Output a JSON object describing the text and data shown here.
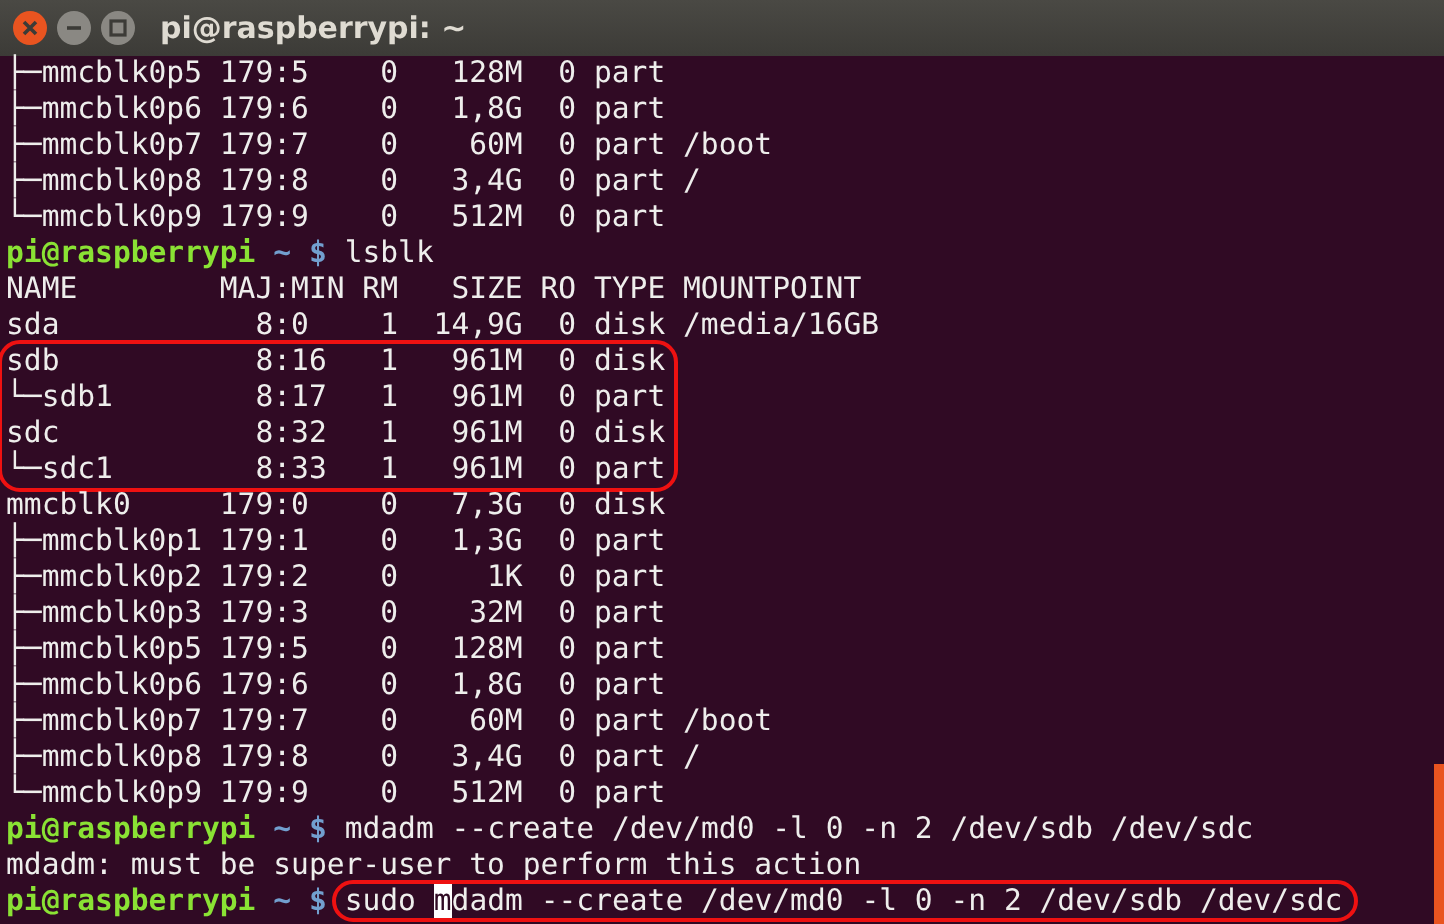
{
  "window": {
    "title": "pi@raspberrypi: ~"
  },
  "terminal": {
    "lines": [
      {
        "kind": "output",
        "text": "├─mmcblk0p5 179:5    0   128M  0 part",
        "highlighted": false
      },
      {
        "kind": "output",
        "text": "├─mmcblk0p6 179:6    0   1,8G  0 part",
        "highlighted": false
      },
      {
        "kind": "output",
        "text": "├─mmcblk0p7 179:7    0    60M  0 part /boot",
        "highlighted": false
      },
      {
        "kind": "output",
        "text": "├─mmcblk0p8 179:8    0   3,4G  0 part /",
        "highlighted": false
      },
      {
        "kind": "output",
        "text": "└─mmcblk0p9 179:9    0   512M  0 part",
        "highlighted": false
      },
      {
        "kind": "prompt",
        "user_host": "pi@raspberrypi",
        "path": "~",
        "symbol": "$",
        "command": "lsblk",
        "highlighted": false
      },
      {
        "kind": "output",
        "text": "NAME        MAJ:MIN RM   SIZE RO TYPE MOUNTPOINT",
        "highlighted": false
      },
      {
        "kind": "output",
        "text": "sda           8:0    1  14,9G  0 disk /media/16GB",
        "highlighted": false
      },
      {
        "kind": "output",
        "text": "sdb           8:16   1   961M  0 disk",
        "highlighted": true
      },
      {
        "kind": "output",
        "text": "└─sdb1        8:17   1   961M  0 part",
        "highlighted": true
      },
      {
        "kind": "output",
        "text": "sdc           8:32   1   961M  0 disk",
        "highlighted": true
      },
      {
        "kind": "output",
        "text": "└─sdc1        8:33   1   961M  0 part",
        "highlighted": true
      },
      {
        "kind": "output",
        "text": "mmcblk0     179:0    0   7,3G  0 disk",
        "highlighted": false
      },
      {
        "kind": "output",
        "text": "├─mmcblk0p1 179:1    0   1,3G  0 part",
        "highlighted": false
      },
      {
        "kind": "output",
        "text": "├─mmcblk0p2 179:2    0     1K  0 part",
        "highlighted": false
      },
      {
        "kind": "output",
        "text": "├─mmcblk0p3 179:3    0    32M  0 part",
        "highlighted": false
      },
      {
        "kind": "output",
        "text": "├─mmcblk0p5 179:5    0   128M  0 part",
        "highlighted": false
      },
      {
        "kind": "output",
        "text": "├─mmcblk0p6 179:6    0   1,8G  0 part",
        "highlighted": false
      },
      {
        "kind": "output",
        "text": "├─mmcblk0p7 179:7    0    60M  0 part /boot",
        "highlighted": false
      },
      {
        "kind": "output",
        "text": "├─mmcblk0p8 179:8    0   3,4G  0 part /",
        "highlighted": false
      },
      {
        "kind": "output",
        "text": "└─mmcblk0p9 179:9    0   512M  0 part",
        "highlighted": false
      },
      {
        "kind": "prompt",
        "user_host": "pi@raspberrypi",
        "path": "~",
        "symbol": "$",
        "command": "mdadm --create /dev/md0 -l 0 -n 2 /dev/sdb /dev/sdc",
        "highlighted": false
      },
      {
        "kind": "output",
        "text": "mdadm: must be super-user to perform this action",
        "highlighted": false
      },
      {
        "kind": "prompt",
        "user_host": "pi@raspberrypi",
        "path": "~",
        "symbol": "$",
        "command": "sudo ",
        "cursor": "m",
        "command_rest": "dadm --create /dev/md0 -l 0 -n 2 /dev/sdb /dev/sdc",
        "highlighted": true
      }
    ]
  }
}
